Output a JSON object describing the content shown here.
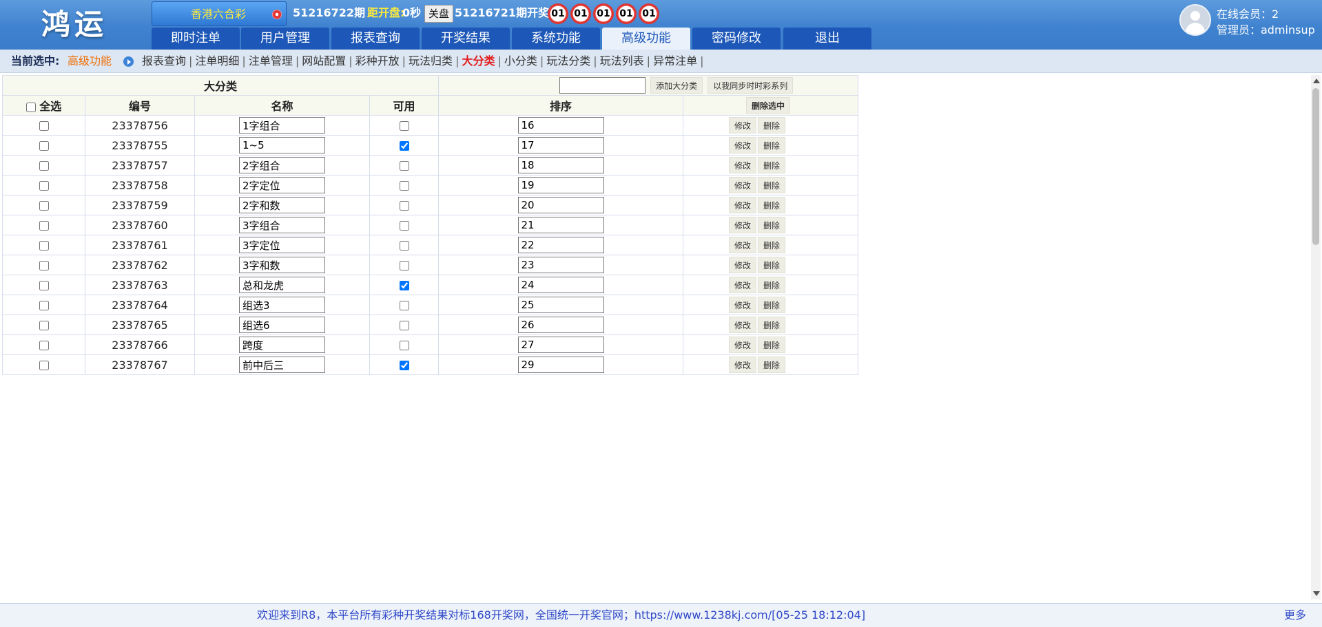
{
  "header": {
    "logo": "鸿运",
    "lottery": "香港六合彩",
    "period": "51216722期",
    "countdown_label": "距开盘:",
    "countdown_value": "0秒",
    "close_label": "关盘",
    "last_draw": "51216721期开奖:",
    "balls": [
      "01",
      "01",
      "01",
      "01",
      "01"
    ],
    "online": "在线会员：2",
    "admin": "管理员：adminsup"
  },
  "nav": [
    "即时注单",
    "用户管理",
    "报表查询",
    "开奖结果",
    "系统功能",
    "高级功能",
    "密码修改",
    "退出"
  ],
  "breadcrumb": {
    "label": "当前选中:",
    "current": "高级功能",
    "links": [
      "报表查询",
      "注单明细",
      "注单管理",
      "网站配置",
      "彩种开放",
      "玩法归类",
      "大分类",
      "小分类",
      "玩法分类",
      "玩法列表",
      "异常注单"
    ]
  },
  "table": {
    "title": "大分类",
    "add_input": "",
    "add_button": "添加大分类",
    "sync_button": "以我同步时时彩系列",
    "delete_selected": "删除选中",
    "headers": {
      "select_all": "全选",
      "id": "编号",
      "name": "名称",
      "enabled": "可用",
      "order": "排序"
    },
    "edit_label": "修改",
    "delete_label": "删除",
    "rows": [
      {
        "id": "23378756",
        "name": "1字组合",
        "enabled": false,
        "order": "16"
      },
      {
        "id": "23378755",
        "name": "1~5",
        "enabled": true,
        "order": "17"
      },
      {
        "id": "23378757",
        "name": "2字组合",
        "enabled": false,
        "order": "18"
      },
      {
        "id": "23378758",
        "name": "2字定位",
        "enabled": false,
        "order": "19"
      },
      {
        "id": "23378759",
        "name": "2字和数",
        "enabled": false,
        "order": "20"
      },
      {
        "id": "23378760",
        "name": "3字组合",
        "enabled": false,
        "order": "21"
      },
      {
        "id": "23378761",
        "name": "3字定位",
        "enabled": false,
        "order": "22"
      },
      {
        "id": "23378762",
        "name": "3字和数",
        "enabled": false,
        "order": "23"
      },
      {
        "id": "23378763",
        "name": "总和龙虎",
        "enabled": true,
        "order": "24"
      },
      {
        "id": "23378764",
        "name": "组选3",
        "enabled": false,
        "order": "25"
      },
      {
        "id": "23378765",
        "name": "组选6",
        "enabled": false,
        "order": "26"
      },
      {
        "id": "23378766",
        "name": "跨度",
        "enabled": false,
        "order": "27"
      },
      {
        "id": "23378767",
        "name": "前中后三",
        "enabled": true,
        "order": "29"
      }
    ]
  },
  "footer": {
    "message": "欢迎来到R8，本平台所有彩种开奖结果对标168开奖网，全国统一开奖官网；https://www.1238kj.com/[05-25 18:12:04]",
    "more": "更多"
  },
  "colors": {
    "header_blue": "#3f82cf",
    "nav_tab": "#1d58b8",
    "countdown_yellow": "#ffeb3b",
    "highlight_red": "#e31b1b",
    "current_orange": "#ef6c00",
    "footer_link": "#2f48c8"
  },
  "icons": {
    "dropdown": "red-circle-dropdown-icon",
    "breadcrumb": "play-arrow-icon",
    "avatar": "user-avatar-icon"
  }
}
